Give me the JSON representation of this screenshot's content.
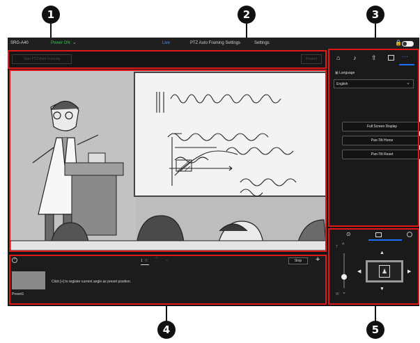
{
  "callouts": [
    "1",
    "2",
    "3",
    "4",
    "5"
  ],
  "topbar": {
    "model": "SRG-A40",
    "power": "Power ON",
    "tabs": [
      "Live",
      "PTZ Auto Framing Settings",
      "Settings"
    ]
  },
  "framing": {
    "start_label": "Start PTZ Auto Framing",
    "restart_label": "Restart"
  },
  "panel": {
    "tabs": [
      "home-icon",
      "music-note-icon",
      "upload-icon",
      "preset-display-icon",
      "more-icon"
    ],
    "language_label": "Language",
    "language_value": "English",
    "buttons": [
      "Full Screen Display",
      "Pan-Tilt Home",
      "Pan-Tilt Reset"
    ]
  },
  "preset": {
    "page": "1",
    "page_total": "/1",
    "stop_label": "Stop",
    "hint": "Click [+] to register current angle as preset position.",
    "thumb_label": "Preset1"
  },
  "ptz": {
    "t_label": "T",
    "w_label": "W"
  },
  "colors": {
    "callout": "#111111",
    "highlight": "#e01818",
    "accent": "#1e6fff",
    "power": "#2ecc40"
  }
}
